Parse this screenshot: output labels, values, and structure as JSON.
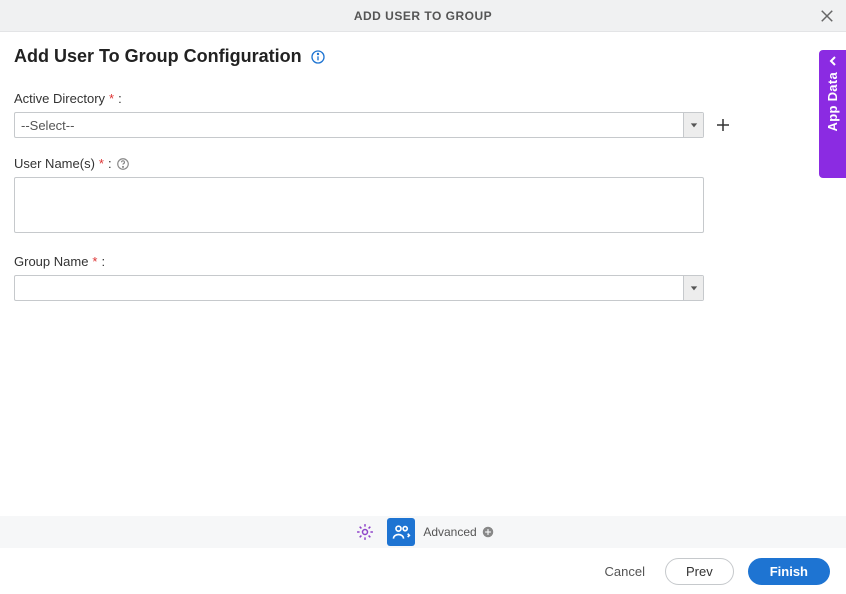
{
  "header": {
    "title": "ADD USER TO GROUP"
  },
  "page": {
    "heading": "Add User To Group Configuration"
  },
  "fields": {
    "active_directory": {
      "label": "Active Directory",
      "value": "--Select--"
    },
    "user_names": {
      "label": "User Name(s)",
      "value": ""
    },
    "group_name": {
      "label": "Group Name",
      "value": ""
    }
  },
  "toolbar": {
    "advanced_label": "Advanced"
  },
  "footer": {
    "cancel": "Cancel",
    "prev": "Prev",
    "finish": "Finish"
  },
  "side_tab": {
    "label": "App Data"
  }
}
